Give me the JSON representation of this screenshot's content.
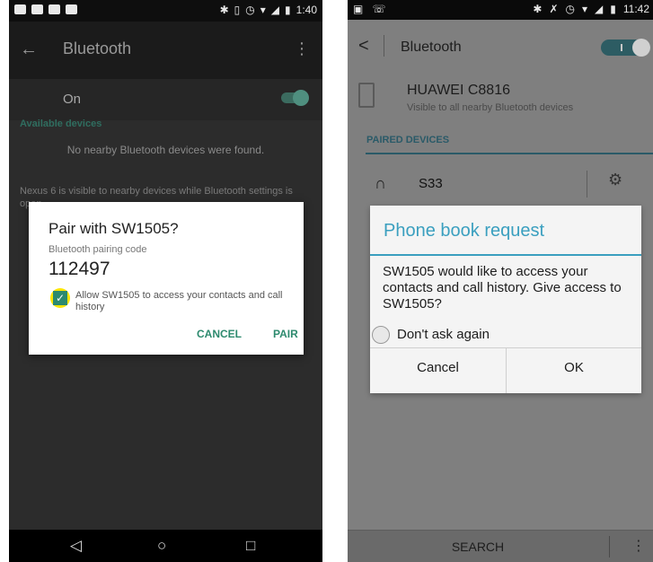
{
  "left_phone": {
    "statusbar": {
      "time": "1:40",
      "icons": [
        "bluetooth-icon",
        "vibrate-icon",
        "alarm-icon",
        "wifi-icon",
        "signal-icon",
        "battery-icon"
      ]
    },
    "toolbar": {
      "back_glyph": "←",
      "title": "Bluetooth",
      "menu_glyph": "⋮"
    },
    "bluetooth_toggle": {
      "label": "On",
      "state": "on"
    },
    "available_section": "Available devices",
    "no_devices_text": "No nearby Bluetooth devices were found.",
    "visibility_text": "Nexus 6 is visible to nearby devices while Bluetooth settings is open.",
    "dialog": {
      "title": "Pair with SW1505?",
      "code_label": "Bluetooth pairing code",
      "code": "112497",
      "checkbox_checked": true,
      "allow_text": "Allow SW1505 to access your contacts and call history",
      "cancel": "CANCEL",
      "pair": "PAIR",
      "accent_color": "#2d8a6e",
      "highlight_color": "#ffe500"
    },
    "navbar": {
      "back": "◁",
      "home": "○",
      "recents": "□"
    }
  },
  "right_phone": {
    "statusbar": {
      "time": "11:42",
      "icons": [
        "bluetooth-icon",
        "mute-icon",
        "alarm-icon",
        "wifi-icon",
        "signal-icon",
        "battery-icon"
      ]
    },
    "header": {
      "back_glyph": "<",
      "title": "Bluetooth",
      "toggle_state": "on"
    },
    "device": {
      "name": "HUAWEI C8816",
      "subtitle": "Visible to all nearby Bluetooth devices"
    },
    "paired_section": "PAIRED DEVICES",
    "paired_devices": [
      {
        "name": "S33"
      }
    ],
    "dialog": {
      "title": "Phone book request",
      "message": "SW1505 would like to access your contacts and call history. Give access to SW1505?",
      "dont_ask": "Don't ask again",
      "cancel": "Cancel",
      "ok": "OK",
      "accent_color": "#3a9fbf"
    },
    "bottom": {
      "search": "SEARCH",
      "more_glyph": "⋮"
    }
  }
}
